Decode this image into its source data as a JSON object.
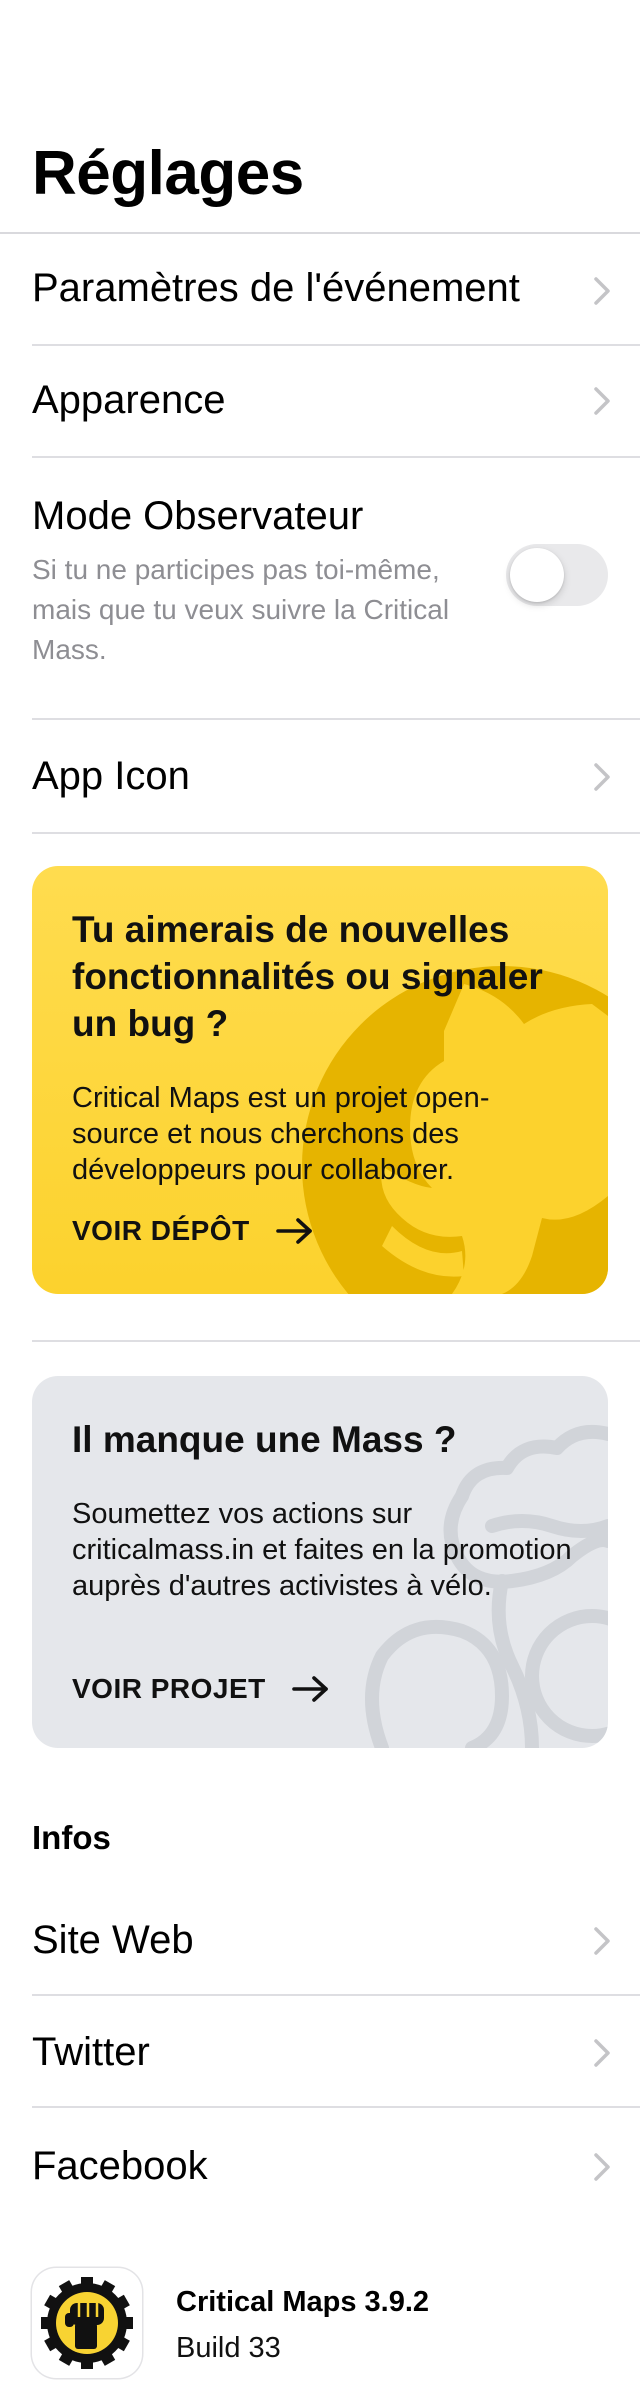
{
  "header": {
    "title": "Réglages"
  },
  "settings": {
    "event_settings_label": "Paramètres de l'événement",
    "appearance_label": "Apparence",
    "observer_mode": {
      "label": "Mode Observateur",
      "description": "Si tu ne participes pas toi-même, mais que tu veux suivre la Critical Mass.",
      "enabled": false
    },
    "app_icon_label": "App Icon"
  },
  "github_card": {
    "title": "Tu aimerais de nouvelles fonctionnalités ou signaler un bug ?",
    "body": "Critical Maps est un projet open-source et nous cherchons des développeurs pour collaborer.",
    "cta": "VOIR DÉPÔT",
    "icon": "github-octocat-icon",
    "color": "#fcd22d"
  },
  "mass_card": {
    "title": "Il manque une Mass ?",
    "body": "Soumettez vos actions sur criticalmass.in et faites en la promotion auprès d'autres activistes à vélo.",
    "cta": "VOIR PROJET",
    "icon": "raised-fist-bike-icon",
    "color": "#e5e7eb"
  },
  "info": {
    "header": "Infos",
    "links": [
      "Site Web",
      "Twitter",
      "Facebook"
    ]
  },
  "app": {
    "name": "Critical Maps 3.9.2",
    "build": "Build 33",
    "icon": "critical-maps-logo-icon"
  },
  "colors": {
    "chevron": "#c4c4c7",
    "secondary_text": "#8e8e93",
    "divider": "#dedee2"
  }
}
